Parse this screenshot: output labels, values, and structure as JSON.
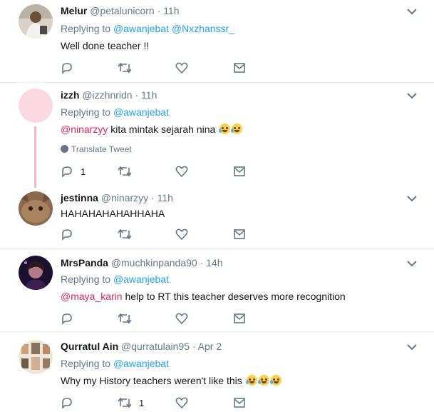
{
  "tweets": [
    {
      "name": "Melur",
      "handle": "@petalunicorn",
      "separator": "·",
      "time": "11h",
      "replying_label": "Replying to",
      "replying_to": [
        "@awanjebat",
        "@Nxzhanssr_"
      ],
      "text": "Well done teacher !!",
      "reply_count": "",
      "retweet_count": ""
    },
    {
      "name": "izzh",
      "handle": "@izzhnridn",
      "separator": "·",
      "time": "11h",
      "replying_label": "Replying to",
      "replying_to": [
        "@awanjebat"
      ],
      "mention": "@ninarzyy",
      "text": "kita mintak sejarah nina",
      "emojis": [
        "face-with-tears-of-joy",
        "face-with-tears-of-joy"
      ],
      "translate": "Translate Tweet",
      "reply_count": "1",
      "retweet_count": ""
    },
    {
      "name": "jestinna",
      "handle": "@ninarzyy",
      "separator": "·",
      "time": "11h",
      "text": "HAHAHAHAHAHHAHA",
      "reply_count": "",
      "retweet_count": ""
    },
    {
      "name": "MrsPanda",
      "handle": "@muchkinpanda90",
      "separator": "·",
      "time": "14h",
      "replying_label": "Replying to",
      "replying_to": [
        "@awanjebat"
      ],
      "mention": "@maya_karin",
      "text": "help to RT this teacher deserves more recognition",
      "reply_count": "",
      "retweet_count": ""
    },
    {
      "name": "Qurratul Ain",
      "handle": "@qurratulain95",
      "separator": "·",
      "time": "Apr 2",
      "replying_label": "Replying to",
      "replying_to": [
        "@awanjebat"
      ],
      "text": "Why my History teachers weren't like this",
      "emojis": [
        "face-with-tears-of-joy",
        "loudly-crying-face",
        "loudly-crying-face"
      ],
      "reply_count": "",
      "retweet_count": "1"
    }
  ],
  "icons": {
    "reply": "reply-icon",
    "retweet": "retweet-icon",
    "like": "heart-icon",
    "dm": "envelope-icon",
    "more": "chevron-down-icon",
    "translate": "globe-icon"
  },
  "colors": {
    "link": "#1da1f2",
    "mention": "#e0245e",
    "muted": "#657786",
    "thread_line": "#f4b7c5"
  }
}
